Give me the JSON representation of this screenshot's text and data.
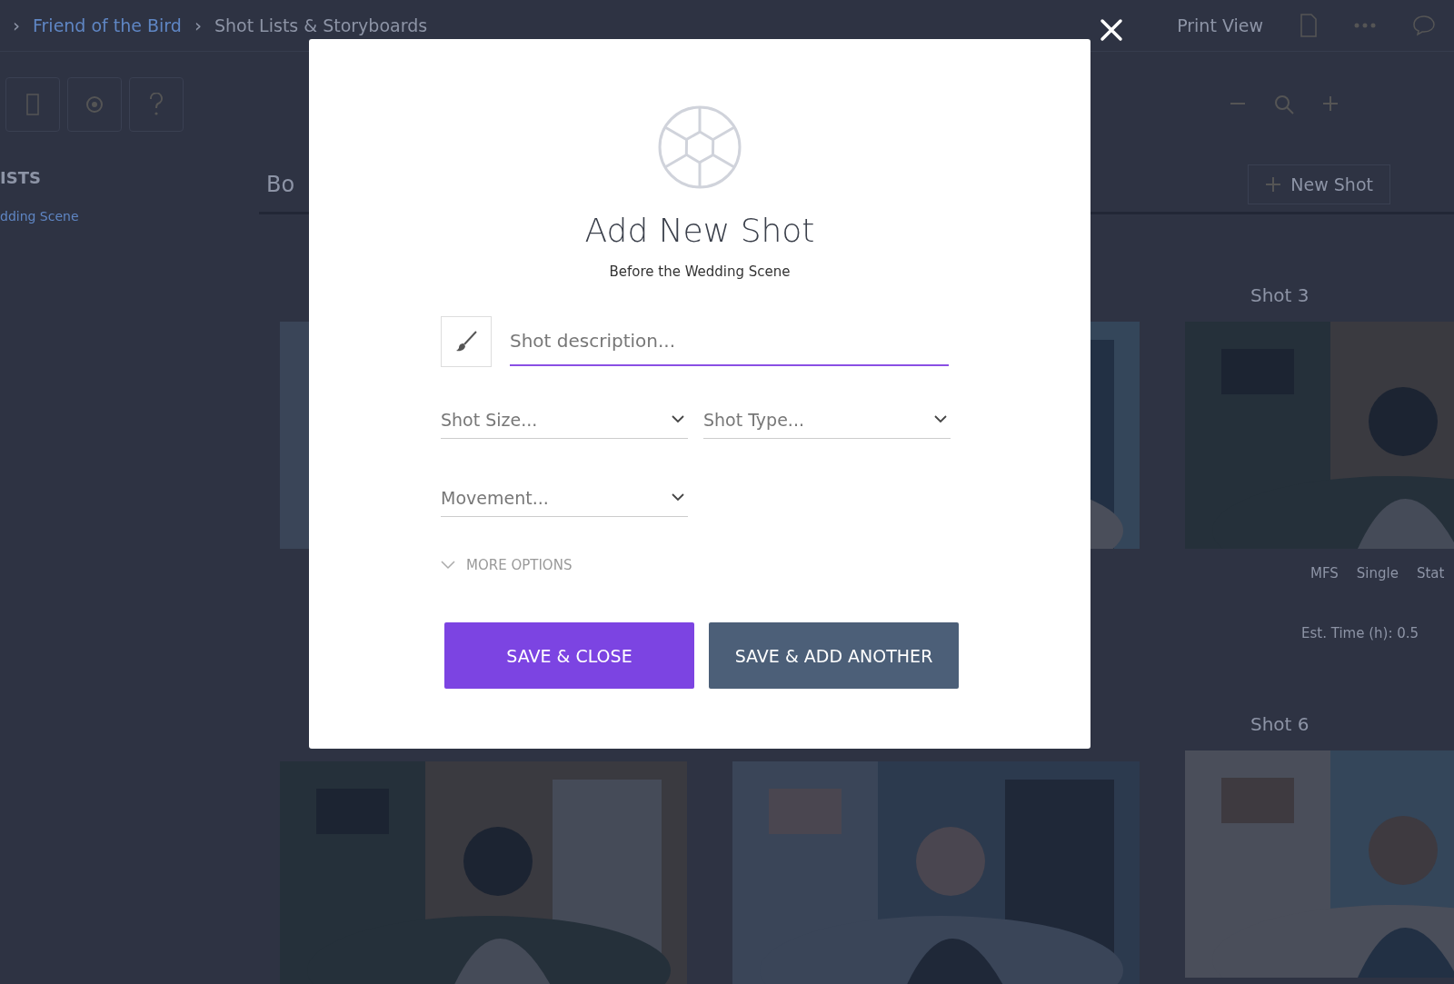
{
  "breadcrumb": [
    {
      "label": "›",
      "kind": "separator"
    },
    {
      "label": "Friend of the Bird",
      "kind": "link"
    },
    {
      "label": "›",
      "kind": "separator"
    },
    {
      "label": "Shot Lists & Storyboards",
      "kind": "current"
    }
  ],
  "print_view": "Print View",
  "sidebar": {
    "heading": "ISTS",
    "items": [
      {
        "label": "dding Scene"
      }
    ]
  },
  "tab": "Bo",
  "new_shot": "New Shot",
  "shots": [
    {
      "title": "Shot 3",
      "tags": [
        "MFS",
        "Single",
        "Stat"
      ],
      "est_time": "Est. Time (h): 0.5"
    },
    {
      "title": "Shot 6"
    }
  ],
  "modal": {
    "title": "Add New Shot",
    "subtitle": "Before the Wedding Scene",
    "description": {
      "placeholder": "Shot description...",
      "focused": true
    },
    "selects": [
      {
        "placeholder": "Shot Size..."
      },
      {
        "placeholder": "Shot Type..."
      },
      {
        "placeholder": "Movement..."
      }
    ],
    "more_options": {
      "label": "MORE OPTIONS",
      "expanded": false
    },
    "buttons": [
      {
        "label": "SAVE & CLOSE",
        "kind": "primary"
      },
      {
        "label": "SAVE & ADD ANOTHER",
        "kind": "secondary"
      }
    ]
  }
}
